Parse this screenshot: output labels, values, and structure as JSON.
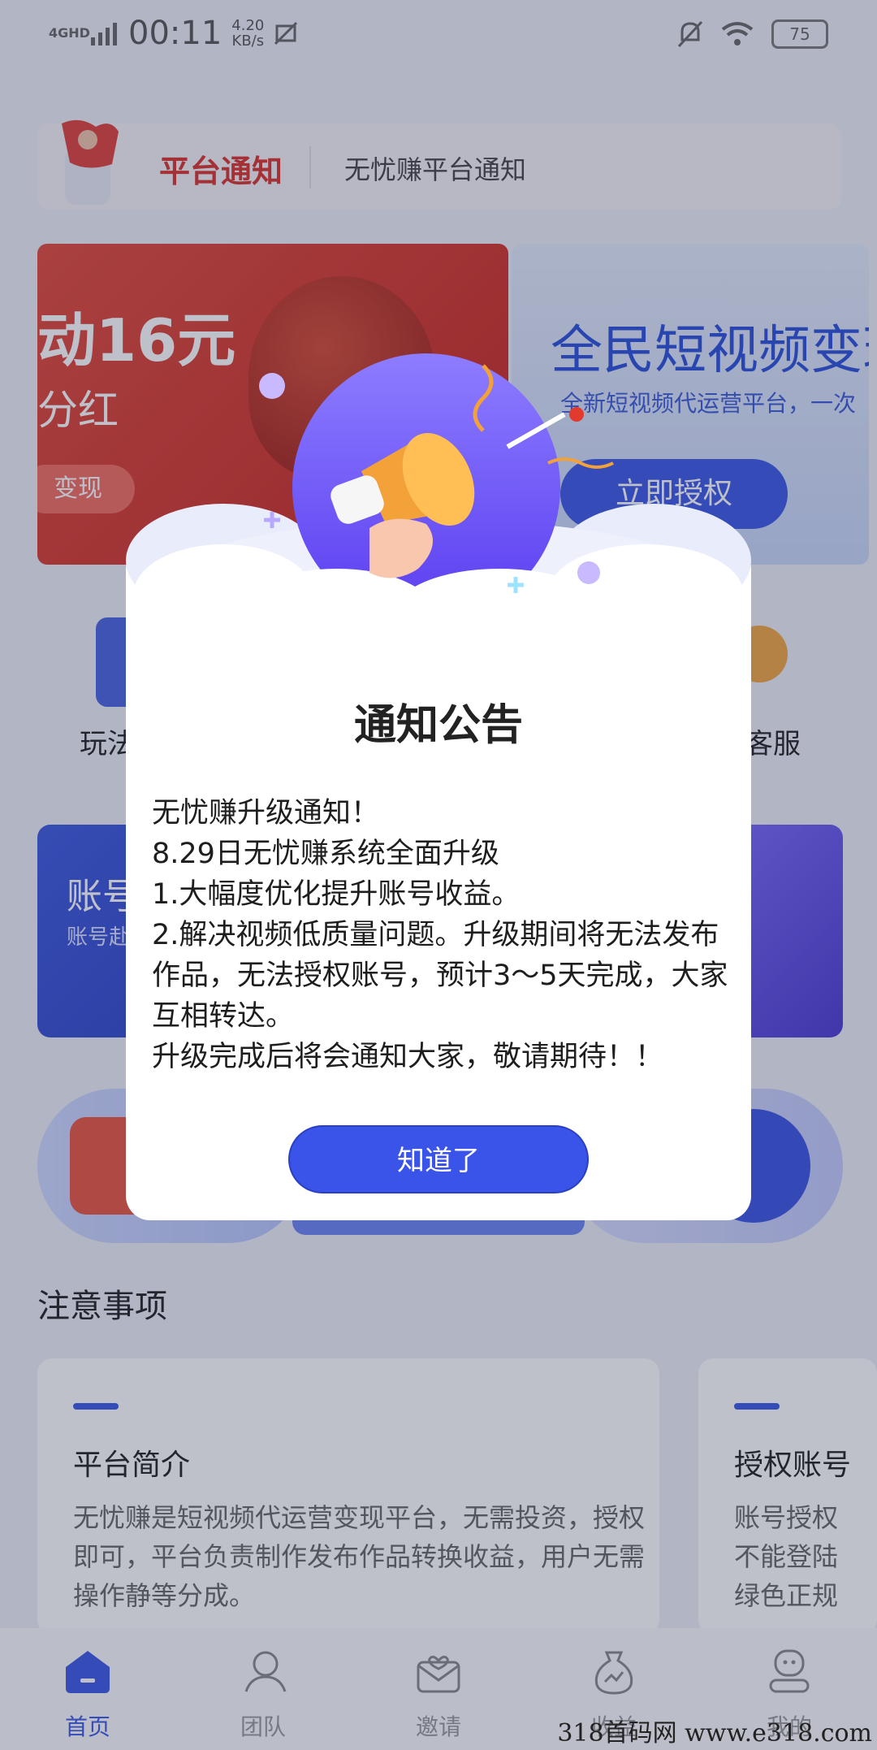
{
  "status_bar": {
    "signal": "4GHD",
    "time": "00:11",
    "net_speed_value": "4.20",
    "net_speed_unit": "KB/s",
    "battery": "75"
  },
  "notice_bar": {
    "title": "平台通知",
    "text": "无忧赚平台通知"
  },
  "banners": {
    "red": {
      "amount": "动16元",
      "subtitle": "分红",
      "button": "变现"
    },
    "blue": {
      "title": "全民短视频变现",
      "subtitle": "全新短视频代运营平台，一次",
      "button": "立即授权"
    }
  },
  "quick_links": {
    "left_label": "玩法",
    "right_label": "客服"
  },
  "cards": {
    "account_title": "账号",
    "account_subtitle": "账号赴"
  },
  "section_title": "注意事项",
  "tips": [
    {
      "title": "平台简介",
      "body": "无忧赚是短视频代运营变现平台，无需投资，授权即可，平台负责制作发布作品转换收益，用户无需操作静等分成。"
    },
    {
      "title": "授权账号",
      "body": "账号授权不能登陆绿色正规"
    }
  ],
  "bottom_nav": [
    {
      "label": "首页",
      "active": true,
      "icon": "home-icon"
    },
    {
      "label": "团队",
      "active": false,
      "icon": "team-icon"
    },
    {
      "label": "邀请",
      "active": false,
      "icon": "invite-icon"
    },
    {
      "label": "收益",
      "active": false,
      "icon": "earnings-icon"
    },
    {
      "label": "我的",
      "active": false,
      "icon": "profile-icon"
    }
  ],
  "dialog": {
    "title": "通知公告",
    "lines": [
      "无忧赚升级通知！",
      "8.29日无忧赚系统全面升级",
      "1.大幅度优化提升账号收益。",
      "2.解决视频低质量问题。升级期间将无法发布作品，无法授权账号，预计3～5天完成，大家互相转达。",
      "升级完成后将会通知大家，敬请期待！！"
    ],
    "button": "知道了"
  },
  "watermark": "318首码网  www.e318.com",
  "colors": {
    "accent": "#3a53e8",
    "notice_red": "#d9332a"
  }
}
